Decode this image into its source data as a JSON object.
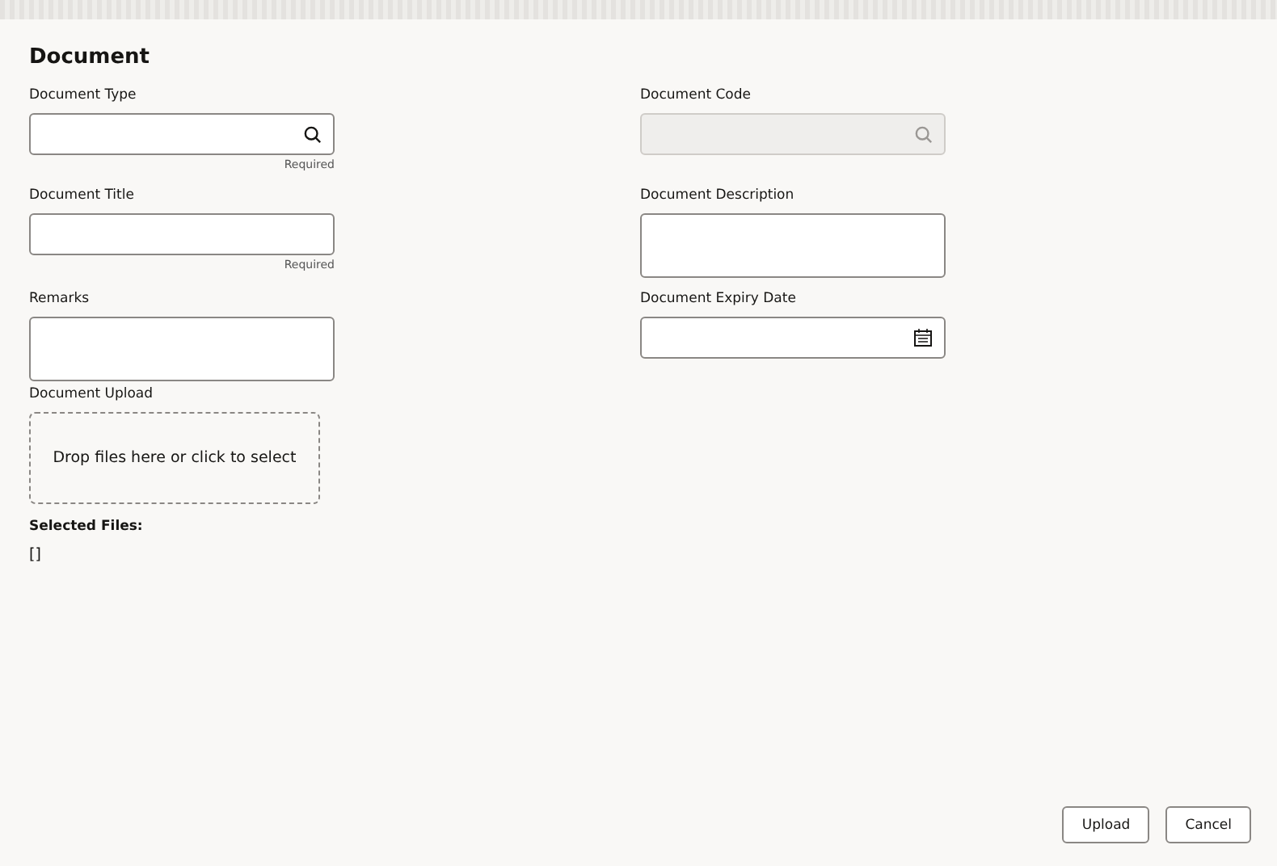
{
  "title": "Document",
  "rows": [
    [
      {
        "label": "Document Type",
        "kind": "search",
        "disabled": false,
        "hint": "Required"
      },
      {
        "label": "Document Code",
        "kind": "search",
        "disabled": true
      }
    ],
    [
      {
        "label": "Document Title",
        "kind": "text",
        "disabled": false,
        "hint": "Required"
      },
      {
        "label": "Document Description",
        "kind": "textarea",
        "disabled": false
      }
    ],
    [
      {
        "label": "Remarks",
        "kind": "textarea",
        "disabled": false
      },
      {
        "label": "Document Expiry Date",
        "kind": "date",
        "disabled": false
      }
    ]
  ],
  "upload": {
    "label": "Document Upload",
    "dropzone": "Drop files here or click to select",
    "selected_label": "Selected Files:",
    "selected_value": "[]"
  },
  "buttons": [
    "Upload",
    "Cancel"
  ]
}
